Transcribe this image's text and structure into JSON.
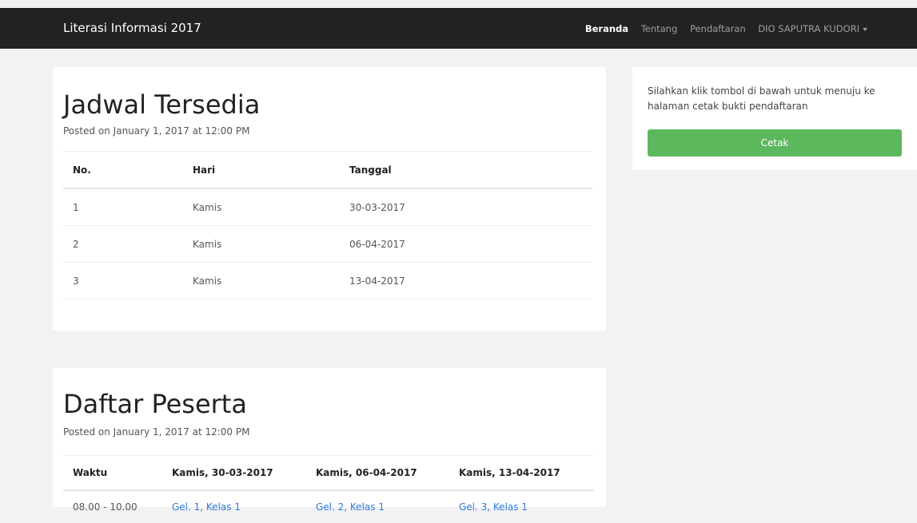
{
  "navbar": {
    "brand": "Literasi Informasi 2017",
    "items": [
      {
        "label": "Beranda",
        "active": true
      },
      {
        "label": "Tentang",
        "active": false
      },
      {
        "label": "Pendaftaran",
        "active": false
      },
      {
        "label": "DIO SAPUTRA KUDORI",
        "active": false
      }
    ]
  },
  "jadwal": {
    "title": "Jadwal Tersedia",
    "posted": "Posted on January 1, 2017 at 12:00 PM",
    "headers": [
      "No.",
      "Hari",
      "Tanggal"
    ],
    "rows": [
      [
        "1",
        "Kamis",
        "30-03-2017"
      ],
      [
        "2",
        "Kamis",
        "06-04-2017"
      ],
      [
        "3",
        "Kamis",
        "13-04-2017"
      ]
    ]
  },
  "peserta": {
    "title": "Daftar Peserta",
    "posted": "Posted on January 1, 2017 at 12:00 PM",
    "headers": [
      "Waktu",
      "Kamis, 30-03-2017",
      "Kamis, 06-04-2017",
      "Kamis, 13-04-2017"
    ],
    "rows": [
      [
        "08.00 - 10.00",
        "Gel. 1, Kelas 1",
        "Gel. 2, Kelas 1",
        "Gel. 3, Kelas 1"
      ]
    ]
  },
  "sidebar": {
    "text": "Silahkan klik tombol di bawah untuk menuju ke halaman cetak bukti pendaftaran",
    "button": "Cetak"
  },
  "colors": {
    "navbar_bg": "#222222",
    "button_green": "#5cb85c",
    "link_blue": "#2a7ae2"
  }
}
